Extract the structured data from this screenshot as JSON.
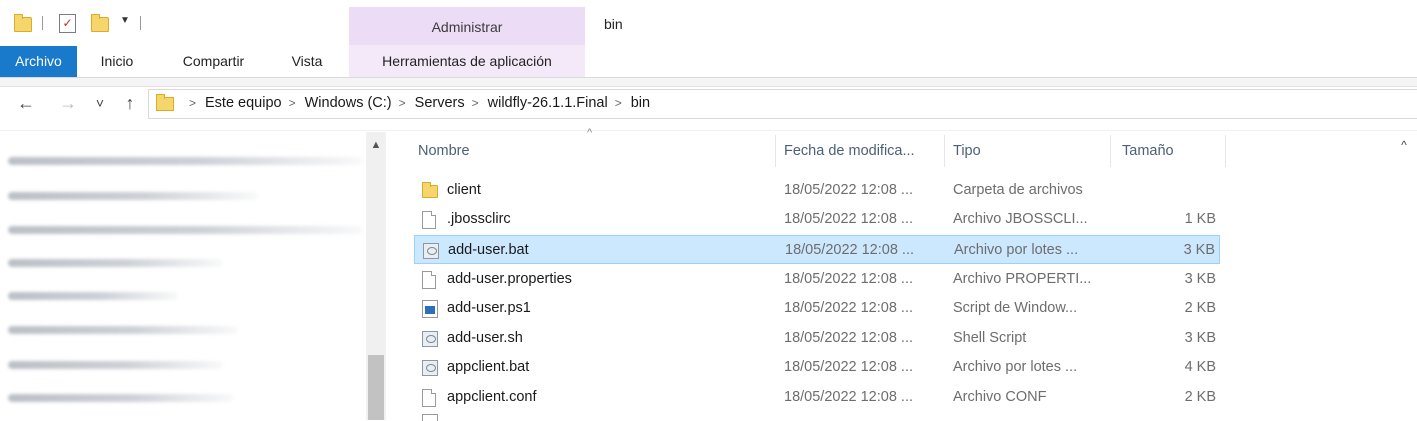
{
  "window": {
    "title": "bin"
  },
  "quick_access": {
    "icons": [
      "folder-icon",
      "properties-icon",
      "new-folder-icon",
      "customize-dropdown-icon"
    ]
  },
  "ribbon": {
    "contextual_header": "Administrar",
    "tabs": [
      {
        "label": "Archivo"
      },
      {
        "label": "Inicio"
      },
      {
        "label": "Compartir"
      },
      {
        "label": "Vista"
      },
      {
        "label": "Herramientas de aplicación"
      }
    ]
  },
  "nav": {
    "back_icon": "←",
    "forward_icon": "→",
    "recent_icon": "˅",
    "up_icon": "↑",
    "breadcrumb": [
      "Este equipo",
      "Windows (C:)",
      "Servers",
      "wildfly-26.1.1.Final",
      "bin"
    ],
    "separator": ">"
  },
  "columns": {
    "name": "Nombre",
    "date": "Fecha de modifica...",
    "type": "Tipo",
    "size": "Tamaño"
  },
  "files": [
    {
      "name": "client",
      "date": "18/05/2022 12:08 ...",
      "type": "Carpeta de archivos",
      "size": "",
      "icon": "folder-icon",
      "selected": false
    },
    {
      "name": ".jbossclirc",
      "date": "18/05/2022 12:08 ...",
      "type": "Archivo JBOSSCLI...",
      "size": "1 KB",
      "icon": "document-icon",
      "selected": false
    },
    {
      "name": "add-user.bat",
      "date": "18/05/2022 12:08 ...",
      "type": "Archivo por lotes ...",
      "size": "3 KB",
      "icon": "batch-file-icon",
      "selected": true
    },
    {
      "name": "add-user.properties",
      "date": "18/05/2022 12:08 ...",
      "type": "Archivo PROPERTI...",
      "size": "3 KB",
      "icon": "document-icon",
      "selected": false
    },
    {
      "name": "add-user.ps1",
      "date": "18/05/2022 12:08 ...",
      "type": "Script de Window...",
      "size": "2 KB",
      "icon": "powershell-script-icon",
      "selected": false
    },
    {
      "name": "add-user.sh",
      "date": "18/05/2022 12:08 ...",
      "type": "Shell Script",
      "size": "3 KB",
      "icon": "batch-file-icon",
      "selected": false
    },
    {
      "name": "appclient.bat",
      "date": "18/05/2022 12:08 ...",
      "type": "Archivo por lotes ...",
      "size": "4 KB",
      "icon": "batch-file-icon",
      "selected": false
    },
    {
      "name": "appclient.conf",
      "date": "18/05/2022 12:08 ...",
      "type": "Archivo CONF",
      "size": "2 KB",
      "icon": "document-icon",
      "selected": false
    }
  ]
}
